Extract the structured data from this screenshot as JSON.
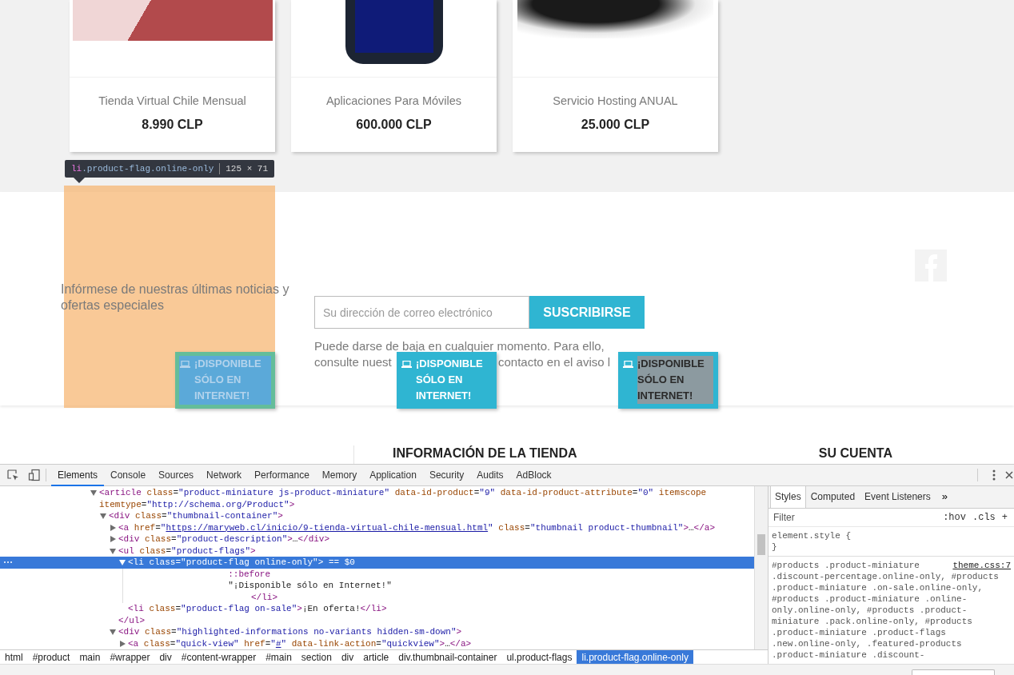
{
  "products": [
    {
      "name": "Tienda Virtual Chile Mensual",
      "price": "8.990 CLP",
      "flag": {
        "label": "¡DISPONIBLE SÓLO EN INTERNET!",
        "inspected": true,
        "text_selected": false
      }
    },
    {
      "name": "Aplicaciones Para Móviles",
      "price": "600.000 CLP",
      "flag": {
        "label": "¡DISPONIBLE SÓLO EN INTERNET!",
        "inspected": false,
        "text_selected": false
      }
    },
    {
      "name": "Servicio Hosting ANUAL",
      "price": "25.000 CLP",
      "flag": {
        "label": "¡DISPONIBLE SÓLO EN INTERNET!",
        "inspected": false,
        "text_selected": true
      }
    }
  ],
  "inspect_tooltip": {
    "tag": "li",
    "classes": ".product-flag.online-only",
    "size": "125 × 71"
  },
  "newsletter": {
    "text": "Infórmese de nuestras últimas noticias y ofertas especiales",
    "email_placeholder": "Su dirección de correo electrónico",
    "button": "SUSCRIBIRSE",
    "note_line": "Puede darse de baja en cualquier momento. Para ello,",
    "note_fragments": [
      "consulte nuest",
      "contacto en el aviso l"
    ]
  },
  "footer": {
    "headings": [
      "INFORMACIÓN DE LA TIENDA",
      "SU CUENTA"
    ]
  },
  "devtools": {
    "tabs": [
      {
        "label": "Elements",
        "selected": true
      },
      {
        "label": "Console",
        "selected": false
      },
      {
        "label": "Sources",
        "selected": false
      },
      {
        "label": "Network",
        "selected": false
      },
      {
        "label": "Performance",
        "selected": false
      },
      {
        "label": "Memory",
        "selected": false
      },
      {
        "label": "Application",
        "selected": false
      },
      {
        "label": "Security",
        "selected": false
      },
      {
        "label": "Audits",
        "selected": false
      },
      {
        "label": "AdBlock",
        "selected": false
      }
    ],
    "dom_tree": [
      {
        "expanded": true,
        "selected": false,
        "tokens": [
          {
            "kind": "tag",
            "text": "<article"
          },
          {
            "kind": "attr",
            "text": " class"
          },
          {
            "kind": "plain",
            "text": "="
          },
          {
            "kind": "val",
            "text": "\"product-miniature js-product-miniature\""
          },
          {
            "kind": "attr",
            "text": " data-id-product"
          },
          {
            "kind": "plain",
            "text": "="
          },
          {
            "kind": "val",
            "text": "\"9\""
          },
          {
            "kind": "attr",
            "text": " data-id-product-attribute"
          },
          {
            "kind": "plain",
            "text": "="
          },
          {
            "kind": "val",
            "text": "\"0\""
          },
          {
            "kind": "attr",
            "text": " itemscope"
          },
          {
            "kind": "attr",
            "text": " itemtype"
          },
          {
            "kind": "plain",
            "text": "="
          },
          {
            "kind": "val",
            "text": "\"http://schema.org/Product\""
          },
          {
            "kind": "tag",
            "text": ">"
          }
        ],
        "children": [
          {
            "expanded": true,
            "selected": false,
            "tokens": [
              {
                "kind": "tag",
                "text": "<div"
              },
              {
                "kind": "attr",
                "text": " class"
              },
              {
                "kind": "plain",
                "text": "="
              },
              {
                "kind": "val",
                "text": "\"thumbnail-container\""
              },
              {
                "kind": "tag",
                "text": ">"
              }
            ],
            "children": [
              {
                "expanded": false,
                "selected": false,
                "tokens": [
                  {
                    "kind": "tag",
                    "text": "<a"
                  },
                  {
                    "kind": "attr",
                    "text": " href"
                  },
                  {
                    "kind": "plain",
                    "text": "="
                  },
                  {
                    "kind": "val",
                    "text": "\""
                  },
                  {
                    "kind": "link",
                    "text": "https://maryweb.cl/inicio/9-tienda-virtual-chile-mensual.html"
                  },
                  {
                    "kind": "val",
                    "text": "\""
                  },
                  {
                    "kind": "attr",
                    "text": " class"
                  },
                  {
                    "kind": "plain",
                    "text": "="
                  },
                  {
                    "kind": "val",
                    "text": "\"thumbnail product-thumbnail\""
                  },
                  {
                    "kind": "tag",
                    "text": ">"
                  },
                  {
                    "kind": "plain",
                    "text": "…"
                  },
                  {
                    "kind": "tag",
                    "text": "</a>"
                  }
                ]
              },
              {
                "expanded": false,
                "selected": false,
                "tokens": [
                  {
                    "kind": "tag",
                    "text": "<div"
                  },
                  {
                    "kind": "attr",
                    "text": " class"
                  },
                  {
                    "kind": "plain",
                    "text": "="
                  },
                  {
                    "kind": "val",
                    "text": "\"product-description\""
                  },
                  {
                    "kind": "tag",
                    "text": ">"
                  },
                  {
                    "kind": "plain",
                    "text": "…"
                  },
                  {
                    "kind": "tag",
                    "text": "</div>"
                  }
                ]
              },
              {
                "expanded": true,
                "selected": false,
                "tokens": [
                  {
                    "kind": "tag",
                    "text": "<ul"
                  },
                  {
                    "kind": "attr",
                    "text": " class"
                  },
                  {
                    "kind": "plain",
                    "text": "="
                  },
                  {
                    "kind": "val",
                    "text": "\"product-flags\""
                  },
                  {
                    "kind": "tag",
                    "text": ">"
                  }
                ],
                "children": [
                  {
                    "expanded": true,
                    "selected": true,
                    "suffix": " == $0",
                    "tokens": [
                      {
                        "kind": "tag",
                        "text": "<li"
                      },
                      {
                        "kind": "attr",
                        "text": " class"
                      },
                      {
                        "kind": "plain",
                        "text": "="
                      },
                      {
                        "kind": "val",
                        "text": "\"product-flag online-only\""
                      },
                      {
                        "kind": "tag",
                        "text": ">"
                      }
                    ],
                    "children": [
                      {
                        "selected": false,
                        "tokens": [
                          {
                            "kind": "tag",
                            "text": "::before"
                          }
                        ]
                      },
                      {
                        "selected": false,
                        "tokens": [
                          {
                            "kind": "plain",
                            "text": "\"¡Disponible sólo en Internet!\""
                          }
                        ]
                      }
                    ],
                    "close": [
                      {
                        "kind": "tag",
                        "text": "</li>"
                      }
                    ]
                  },
                  {
                    "selected": false,
                    "tokens": [
                      {
                        "kind": "tag",
                        "text": "<li"
                      },
                      {
                        "kind": "attr",
                        "text": " class"
                      },
                      {
                        "kind": "plain",
                        "text": "="
                      },
                      {
                        "kind": "val",
                        "text": "\"product-flag on-sale\""
                      },
                      {
                        "kind": "tag",
                        "text": ">"
                      },
                      {
                        "kind": "plain",
                        "text": "¡En oferta!"
                      },
                      {
                        "kind": "tag",
                        "text": "</li>"
                      }
                    ]
                  }
                ],
                "close": [
                  {
                    "kind": "tag",
                    "text": "</ul>"
                  }
                ]
              },
              {
                "expanded": true,
                "selected": false,
                "tokens": [
                  {
                    "kind": "tag",
                    "text": "<div"
                  },
                  {
                    "kind": "attr",
                    "text": " class"
                  },
                  {
                    "kind": "plain",
                    "text": "="
                  },
                  {
                    "kind": "val",
                    "text": "\"highlighted-informations no-variants hidden-sm-down\""
                  },
                  {
                    "kind": "tag",
                    "text": ">"
                  }
                ],
                "children": [
                  {
                    "expanded": false,
                    "selected": false,
                    "tokens": [
                      {
                        "kind": "tag",
                        "text": "<a"
                      },
                      {
                        "kind": "attr",
                        "text": " class"
                      },
                      {
                        "kind": "plain",
                        "text": "="
                      },
                      {
                        "kind": "val",
                        "text": "\"quick-view\""
                      },
                      {
                        "kind": "attr",
                        "text": " href"
                      },
                      {
                        "kind": "plain",
                        "text": "="
                      },
                      {
                        "kind": "val",
                        "text": "\""
                      },
                      {
                        "kind": "link",
                        "text": "#"
                      },
                      {
                        "kind": "val",
                        "text": "\""
                      },
                      {
                        "kind": "attr",
                        "text": " data-link-action"
                      },
                      {
                        "kind": "plain",
                        "text": "="
                      },
                      {
                        "kind": "val",
                        "text": "\"quickview\""
                      },
                      {
                        "kind": "tag",
                        "text": ">"
                      },
                      {
                        "kind": "plain",
                        "text": "…"
                      },
                      {
                        "kind": "tag",
                        "text": "</a>"
                      }
                    ]
                  }
                ]
              }
            ]
          }
        ]
      }
    ],
    "breadcrumb": [
      {
        "label": "html",
        "selected": false
      },
      {
        "label": "#product",
        "selected": false
      },
      {
        "label": "main",
        "selected": false
      },
      {
        "label": "#wrapper",
        "selected": false
      },
      {
        "label": "div",
        "selected": false
      },
      {
        "label": "#content-wrapper",
        "selected": false
      },
      {
        "label": "#main",
        "selected": false
      },
      {
        "label": "section",
        "selected": false
      },
      {
        "label": "div",
        "selected": false
      },
      {
        "label": "article",
        "selected": false
      },
      {
        "label": "div.thumbnail-container",
        "selected": false
      },
      {
        "label": "ul.product-flags",
        "selected": false
      },
      {
        "label": "li.product-flag.online-only",
        "selected": true
      }
    ],
    "styles_pane": {
      "tabs": [
        {
          "label": "Styles",
          "selected": true
        },
        {
          "label": "Computed",
          "selected": false
        },
        {
          "label": "Event Listeners",
          "selected": false
        }
      ],
      "more": "»",
      "filter_placeholder": "Filter",
      "hov": ":hov",
      "cls": ".cls",
      "add": "+",
      "element_style": {
        "selector": "element.style {",
        "close": "}"
      },
      "rule": {
        "selector_first_line": "#products .product-miniature",
        "selector_rest": ".discount-percentage.online-only, #products .product-miniature .on-sale.online-only, #products .product-miniature .online-only.online-only, #products .product-miniature .pack.online-only, #products .product-miniature .product-flags .new.online-only, .featured-products .product-miniature .discount-",
        "source": "theme.css:7"
      }
    }
  }
}
